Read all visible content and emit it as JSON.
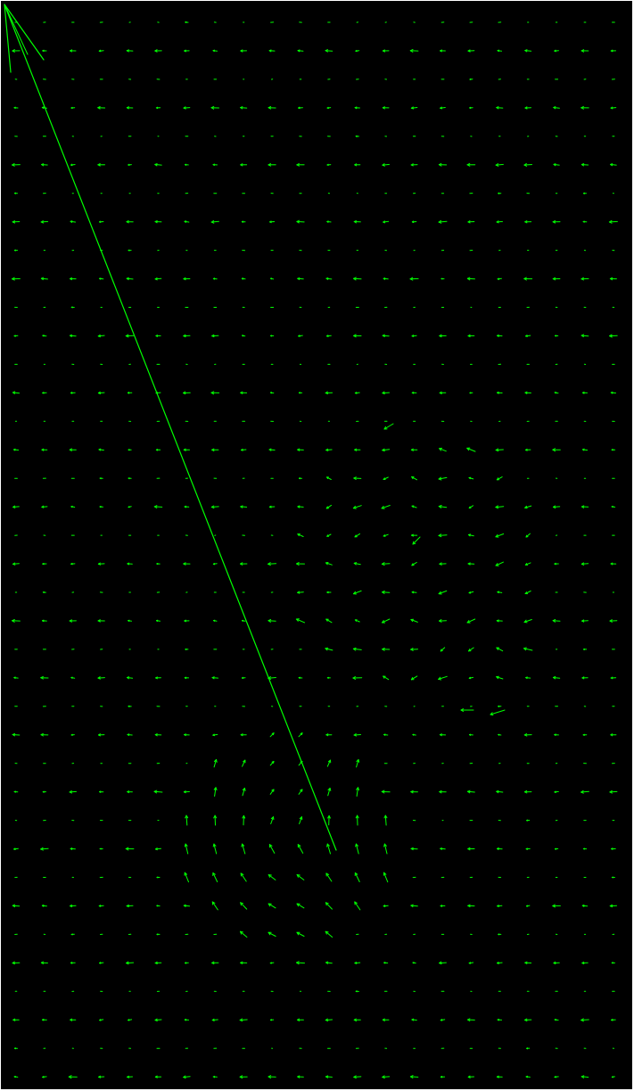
{
  "colors": {
    "background": "#000000",
    "border": "#ffffff",
    "vector": "#00ff00"
  },
  "vector_field": {
    "grid_columns": 22,
    "grid_rows": 38,
    "arrow_style": "single-headed",
    "dominant_direction": "leftward",
    "long_vector": {
      "description_visible": false,
      "from_region": "lower-middle",
      "to_region": "top-left corner"
    }
  }
}
